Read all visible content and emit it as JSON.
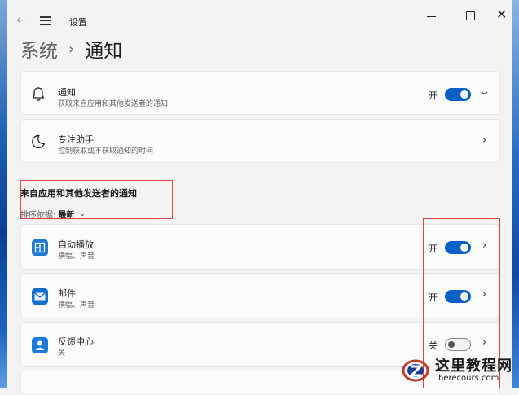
{
  "window": {
    "app_title": "设置",
    "back_icon": "back-arrow-icon",
    "menu_icon": "hamburger-icon",
    "close_glyph": "✕"
  },
  "breadcrumb": {
    "parent": "系统",
    "separator": "›",
    "current": "通知"
  },
  "notifications_card": {
    "icon": "bell-icon",
    "title": "通知",
    "subtitle": "获取来自应用和其他发送者的通知",
    "state_label": "开",
    "toggle_on": true,
    "chevron": "⌄"
  },
  "focus_card": {
    "icon": "moon-icon",
    "title": "专注助手",
    "subtitle": "控制获取或不获取通知的时间",
    "chevron": "›"
  },
  "apps_section": {
    "title": "来自应用和其他发送者的通知",
    "sort_label": "排序依据:",
    "sort_value": "最新",
    "sort_chevron": "⌄",
    "apps": [
      {
        "name": "自动播放",
        "detail": "横幅、声音",
        "state_label": "开",
        "toggle_on": true,
        "icon": "autoplay-icon",
        "chevron": "›"
      },
      {
        "name": "邮件",
        "detail": "横幅、声音",
        "state_label": "开",
        "toggle_on": true,
        "icon": "mail-icon",
        "chevron": "›"
      },
      {
        "name": "反馈中心",
        "detail": "关",
        "state_label": "关",
        "toggle_on": false,
        "icon": "feedback-hub-icon",
        "chevron": "›"
      }
    ]
  },
  "watermark": {
    "text": "这里教程网",
    "url": "herecours.com"
  },
  "colors": {
    "accent": "#0b60c7",
    "highlight_box": "#e0443f",
    "background": "#f3f3f3",
    "card": "#fbfbfb"
  }
}
